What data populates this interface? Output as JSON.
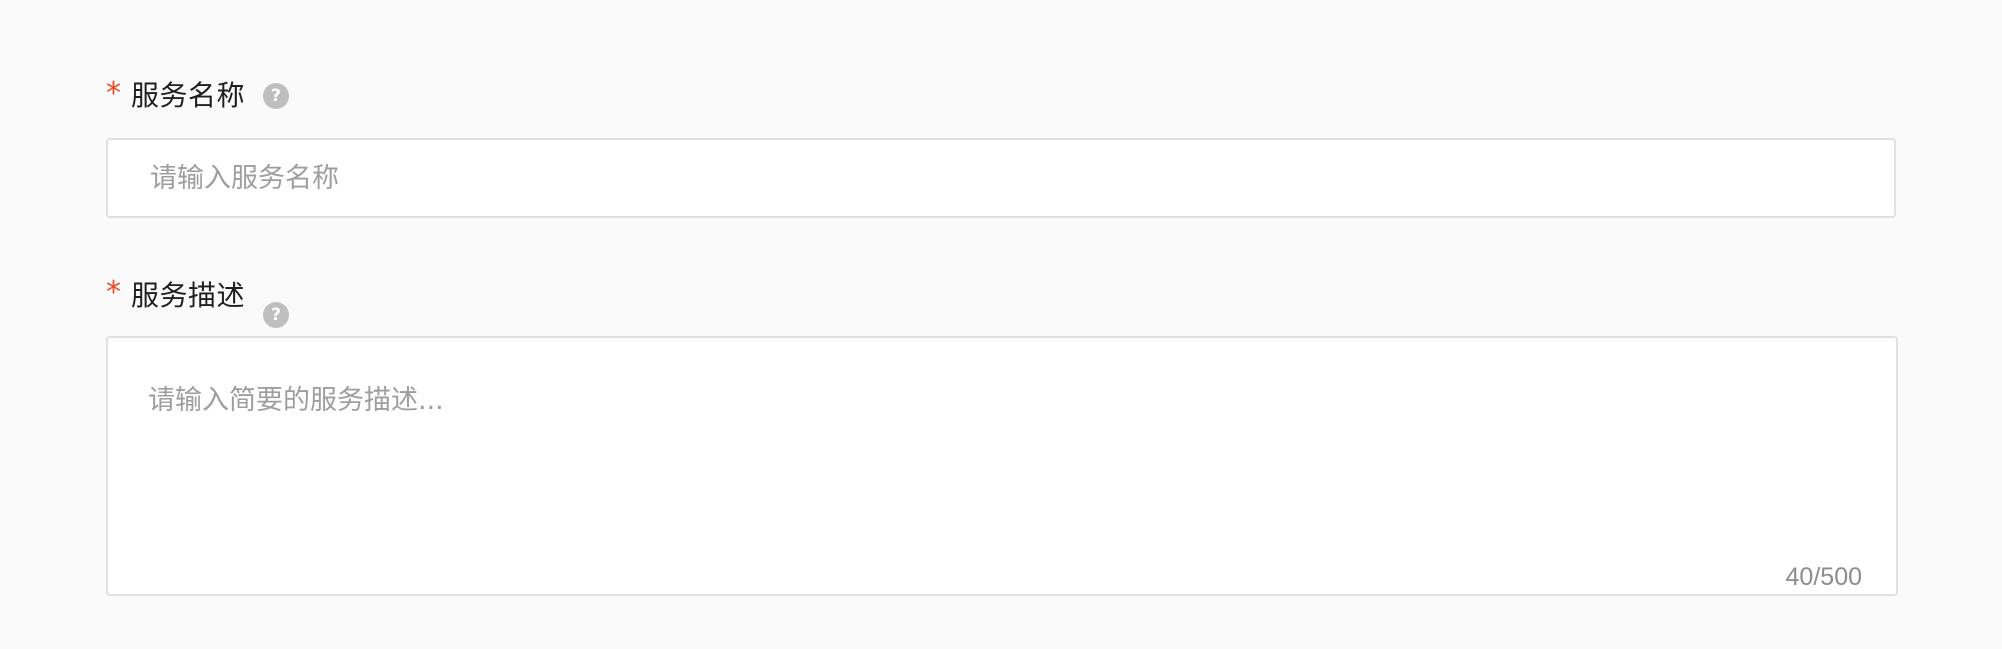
{
  "form": {
    "service_name": {
      "required_mark": "*",
      "label": "服务名称",
      "help_glyph": "?",
      "placeholder": "请输入服务名称",
      "value": ""
    },
    "service_description": {
      "required_mark": "*",
      "label": "服务描述",
      "help_glyph": "?",
      "placeholder": "请输入简要的服务描述...",
      "value": "",
      "counter": "40/500"
    }
  },
  "colors": {
    "required": "#ef4a23",
    "help_icon_bg": "#bfbfbf",
    "border": "#e0e0e0",
    "placeholder": "#9e9e9e"
  },
  "icons": {
    "help": "question-circle-icon"
  }
}
